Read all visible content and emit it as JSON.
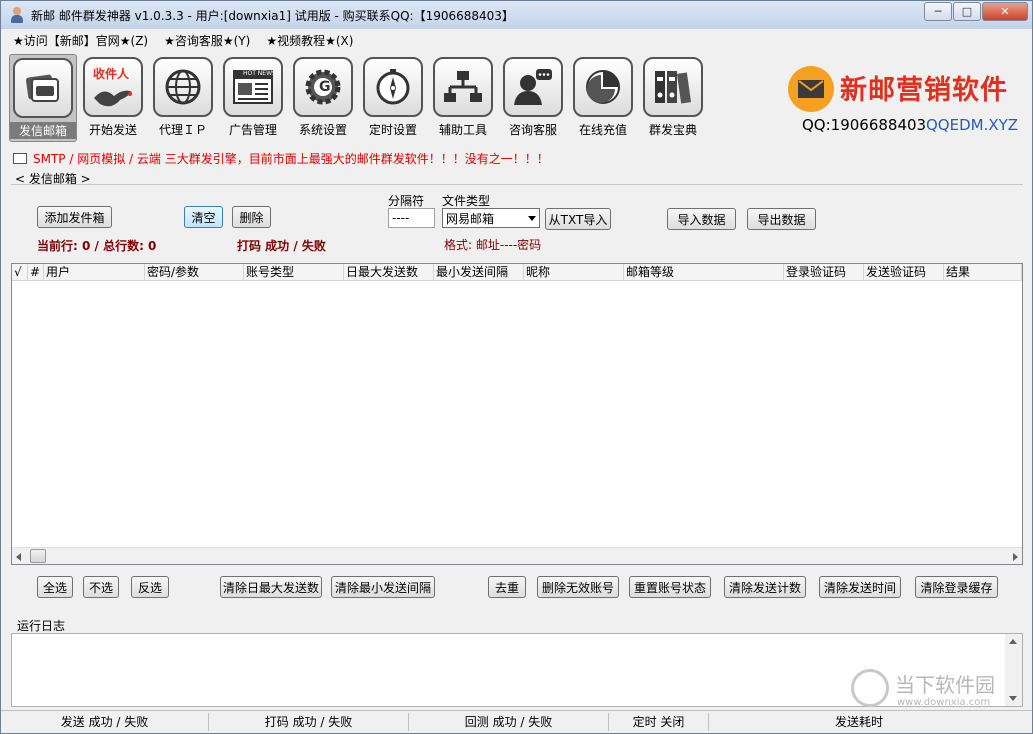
{
  "window": {
    "title": "新邮 邮件群发神器 v1.0.3.3 - 用户:[downxia1] 试用版 - 购买联系QQ:【1906688403】",
    "min": "─",
    "max": "□",
    "close": "✕"
  },
  "menu": [
    "★访问【新邮】官网★(Z)",
    "★咨询客服★(Y)",
    "★视频教程★(X)"
  ],
  "toolbar": [
    {
      "label": "发信邮箱",
      "icon": "mailbox-icon",
      "active": true
    },
    {
      "label": "开始发送",
      "icon": "bird-recipient-icon",
      "badge": "收件人"
    },
    {
      "label": "代理ＩＰ",
      "icon": "globe-icon"
    },
    {
      "label": "广告管理",
      "icon": "news-icon",
      "badge": "HOT NEWS"
    },
    {
      "label": "系统设置",
      "icon": "gear-icon",
      "badge": "G"
    },
    {
      "label": "定时设置",
      "icon": "compass-clock-icon"
    },
    {
      "label": "辅助工具",
      "icon": "network-icon"
    },
    {
      "label": "咨询客服",
      "icon": "support-icon"
    },
    {
      "label": "在线充值",
      "icon": "pie-chart-icon"
    },
    {
      "label": "群发宝典",
      "icon": "binders-icon"
    }
  ],
  "brand": {
    "title": "新邮营销软件",
    "qq": "QQ:1906688403",
    "url": "QQEDM.XYZ"
  },
  "notice": "SMTP / 网页模拟 / 云端 三大群发引擎，目前市面上最强大的邮件群发软件！！！没有之一！！！",
  "group": "< 发信邮箱 >",
  "controls": {
    "add": "添加发件箱",
    "clear": "清空",
    "delete": "删除",
    "sep_label": "分隔符",
    "sep_value": "----",
    "type_label": "文件类型",
    "type_value": "网易邮箱",
    "import_txt": "从TXT导入",
    "import_data": "导入数据",
    "export_data": "导出数据",
    "row_info": "当前行: 0 / 总行数: 0",
    "captcha": "打码 成功 / 失败",
    "format": "格式: 邮址----密码"
  },
  "columns": [
    "√",
    "#",
    "用户",
    "密码/参数",
    "账号类型",
    "日最大发送数",
    "最小发送间隔",
    "昵称",
    "邮箱等级",
    "登录验证码",
    "发送验证码",
    "结果"
  ],
  "bottom_buttons": [
    "全选",
    "不选",
    "反选",
    "清除日最大发送数",
    "清除最小发送间隔",
    "去重",
    "删除无效账号",
    "重置账号状态",
    "清除发送计数",
    "清除发送时间",
    "清除登录缓存"
  ],
  "log_label": "运行日志",
  "status": [
    "发送 成功 / 失败",
    "打码 成功 / 失败",
    "回测 成功 / 失败",
    "定时 关闭",
    "发送耗时"
  ],
  "watermark": {
    "title": "当下软件园",
    "url": "www.downxia.com"
  }
}
